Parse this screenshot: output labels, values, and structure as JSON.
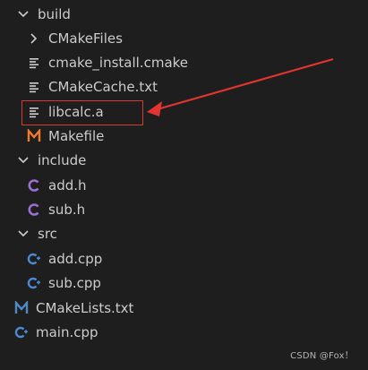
{
  "tree": {
    "build": "build",
    "cmakefiles": "CMakeFiles",
    "cmake_install": "cmake_install.cmake",
    "cmakecache": "CMakeCache.txt",
    "libcalc": "libcalc.a",
    "makefile": "Makefile",
    "include": "include",
    "add_h": "add.h",
    "sub_h": "sub.h",
    "src": "src",
    "add_cpp": "add.cpp",
    "sub_cpp": "sub.cpp",
    "cmakelists": "CMakeLists.txt",
    "main_cpp": "main.cpp"
  },
  "watermark": "CSDN @Fox！",
  "colors": {
    "text": "#cccccc",
    "icon_gray": "#cfcfcf",
    "cmake_icon": "#4f88c6",
    "h_icon": "#9b6fd1",
    "cpp_icon": "#4a8ad0",
    "make_icon": "#f27b2b",
    "highlight": "#d83a2f"
  },
  "icons": {
    "folder_open": "chevron-down-icon",
    "folder_closed": "chevron-right-icon",
    "text_file": "lines-icon",
    "cmake_file": "m-icon",
    "makefile": "m-icon",
    "header": "c-icon",
    "cpp": "cpp-icon"
  }
}
